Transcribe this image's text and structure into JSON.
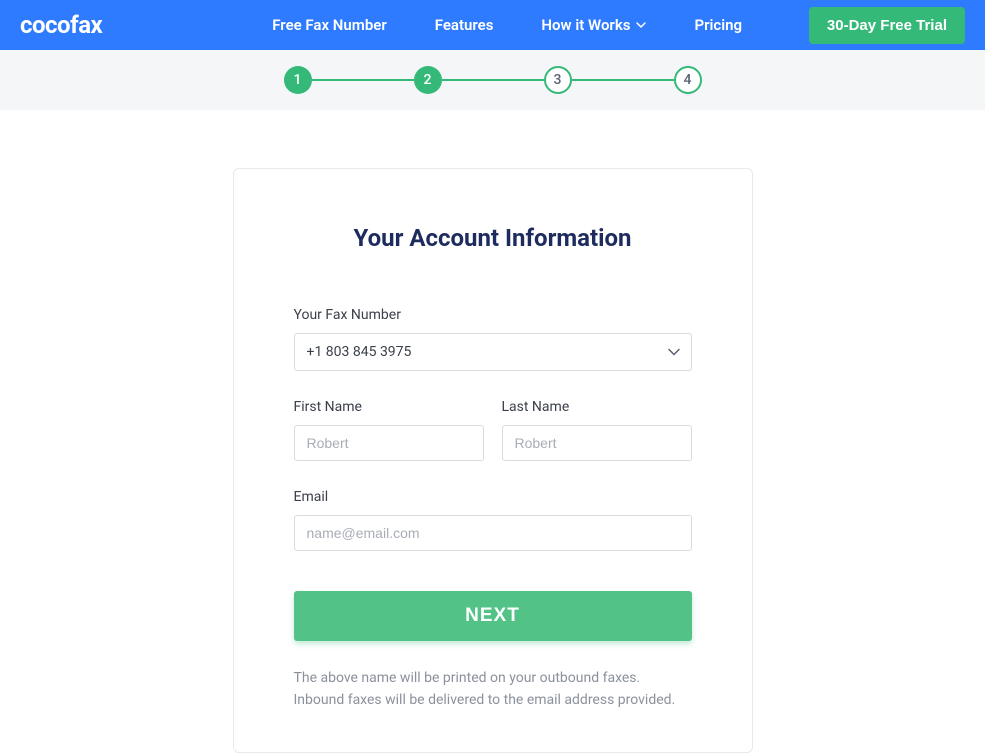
{
  "header": {
    "logo": "cocofax",
    "nav": {
      "free_fax": "Free Fax Number",
      "features": "Features",
      "how_it_works": "How it Works",
      "pricing": "Pricing"
    },
    "trial_button": "30-Day Free Trial"
  },
  "stepper": {
    "steps": [
      "1",
      "2",
      "3",
      "4"
    ],
    "current": 2
  },
  "form": {
    "title": "Your Account Information",
    "fax_number": {
      "label": "Your Fax Number",
      "value": "+1 803 845 3975"
    },
    "first_name": {
      "label": "First Name",
      "placeholder": "Robert"
    },
    "last_name": {
      "label": "Last Name",
      "placeholder": "Robert"
    },
    "email": {
      "label": "Email",
      "placeholder": "name@email.com"
    },
    "next_button": "NEXT",
    "disclaimer_line1": "The above name will be printed on your outbound faxes.",
    "disclaimer_line2": "Inbound faxes will be delivered to the email address provided."
  }
}
